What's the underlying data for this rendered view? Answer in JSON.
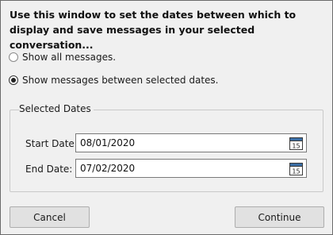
{
  "instructions": "Use this window to set the dates between which to display and save messages in your selected conversation...",
  "options": {
    "show_all": {
      "label": "Show all messages.",
      "checked": false
    },
    "show_between": {
      "label": "Show messages between selected dates.",
      "checked": true
    }
  },
  "group": {
    "title": "Selected Dates",
    "start": {
      "label": "Start Date:",
      "value": "08/01/2020",
      "icon_text": "15"
    },
    "end": {
      "label": "End Date:",
      "value": "07/02/2020",
      "icon_text": "15"
    }
  },
  "buttons": {
    "cancel": "Cancel",
    "continue": "Continue"
  }
}
